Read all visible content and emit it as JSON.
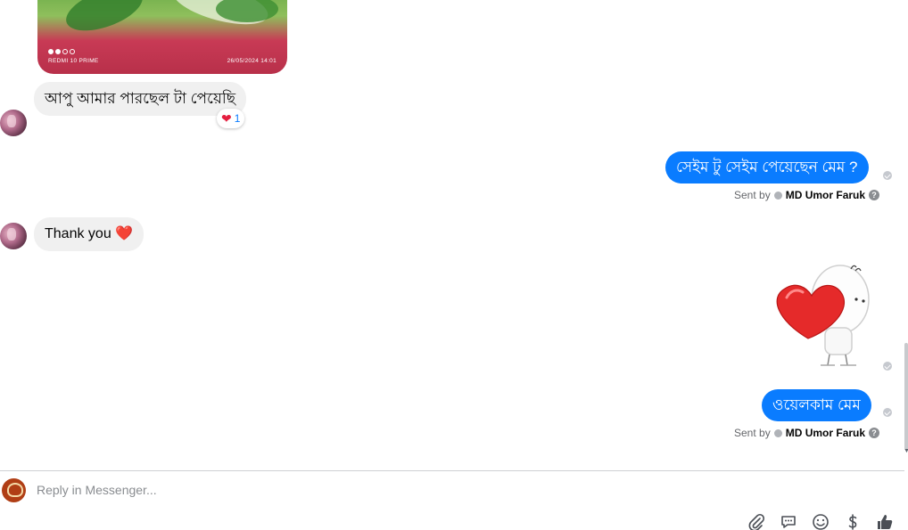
{
  "thread": {
    "photo": {
      "camera_label": "REDMI 10 PRIME",
      "timestamp": "26/05/2024  14:01"
    },
    "messages": [
      {
        "text": "আপু আমার পারছেল টা পেয়েছি",
        "reaction": {
          "emoji": "❤️",
          "count": "1"
        }
      },
      {
        "text": "সেইম টু সেইম পেয়েছেন মেম ?",
        "sent_by_prefix": "Sent by",
        "sent_by_name": "MD Umor Faruk"
      },
      {
        "text": "Thank you ❤️"
      },
      {
        "sticker": "heart-hug-sticker"
      },
      {
        "text": "ওয়েলকাম মেম",
        "sent_by_prefix": "Sent by",
        "sent_by_name": "MD Umor Faruk"
      }
    ]
  },
  "composer": {
    "placeholder": "Reply in Messenger..."
  },
  "icons": [
    "attachment-icon",
    "saved-replies-icon",
    "emoji-icon",
    "dollar-icon",
    "like-icon"
  ],
  "colors": {
    "outgoing_bubble": "#0a7cff",
    "incoming_bubble": "#f0f0f0",
    "heart": "#e41e3f"
  }
}
